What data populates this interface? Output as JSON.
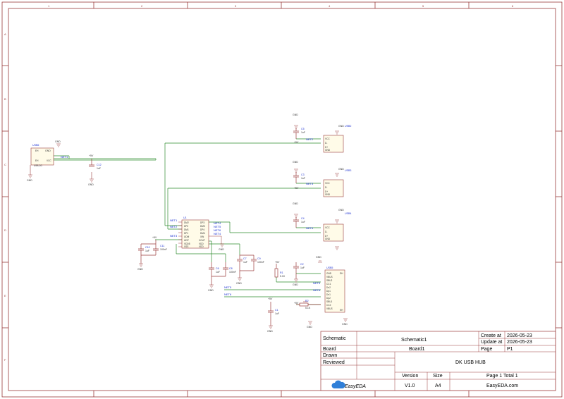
{
  "title_block": {
    "schematic_label": "Schematic",
    "schematic_name": "Schematic1",
    "board_label": "Board",
    "board_name": "Board1",
    "drawn_label": "Drawn",
    "reviewed_label": "Reviewed",
    "create_at_label": "Create at",
    "create_at": "2026-05-23",
    "update_at_label": "Update at",
    "update_at": "2026-05-23",
    "page_label": "Page",
    "page_value": "P1",
    "project_title": "DK USB HUB",
    "version_label": "Version",
    "version": "V1.0",
    "size_label": "Size",
    "size": "A4",
    "page_total": "Page  1  Total  1",
    "logo_text": "EasyEDA",
    "website": "EasyEDA.com"
  },
  "border": {
    "row_letters": [
      "A",
      "B",
      "C",
      "D",
      "E",
      "F"
    ],
    "col_numbers": [
      "1",
      "2",
      "3",
      "4",
      "5",
      "6"
    ]
  },
  "labels": {
    "usb_in": "USB6",
    "usb_in_name": "USB-2G",
    "usb2": "USB2",
    "usb3": "USB3",
    "usb4": "USB4",
    "usb5": "USB5",
    "u1": "U1",
    "gnd": "GND",
    "vcc5": "+5V",
    "c5": "C5",
    "c5_val": "1uF",
    "c3": "C3",
    "c3_val": "1uF",
    "c4": "C4",
    "c4_val": "1uF",
    "c12": "C12",
    "c12_val": "1uF",
    "c10": "C10",
    "c10_val": "1uF",
    "c11": "C11",
    "c11_val": "100nF",
    "c6": "C6",
    "c6_val": "1uF",
    "c8": "C8",
    "c8_val": "100nF",
    "c7": "C7",
    "c7_val": "1uF",
    "c9": "C9",
    "c9_val": "100nF",
    "c2": "C2",
    "c2_val": "1uF",
    "c1": "C1",
    "c1_val": "1uF",
    "r1": "R1",
    "r1_val": "5.1K",
    "r2": "R2",
    "r2_val": "5.1K",
    "net1": "NET1",
    "net2": "NET2",
    "net3": "NET3",
    "net4": "NET4",
    "net5": "NET5",
    "net6": "NET6"
  }
}
